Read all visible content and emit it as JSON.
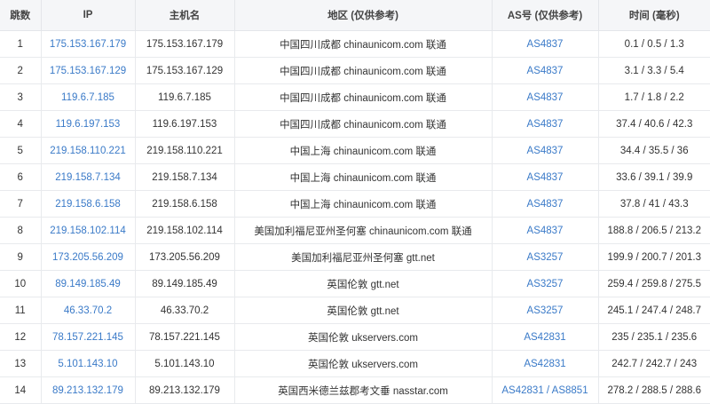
{
  "headers": {
    "hop": "跳数",
    "ip": "IP",
    "hostname": "主机名",
    "region": "地区 (仅供参考)",
    "as": "AS号 (仅供参考)",
    "time": "时间 (毫秒)"
  },
  "rows": [
    {
      "hop": "1",
      "ip": "175.153.167.179",
      "hostname": "175.153.167.179",
      "region": "中国四川成都 chinaunicom.com 联通",
      "as": [
        "AS4837"
      ],
      "time": "0.1 / 0.5 / 1.3"
    },
    {
      "hop": "2",
      "ip": "175.153.167.129",
      "hostname": "175.153.167.129",
      "region": "中国四川成都 chinaunicom.com 联通",
      "as": [
        "AS4837"
      ],
      "time": "3.1 / 3.3 / 5.4"
    },
    {
      "hop": "3",
      "ip": "119.6.7.185",
      "hostname": "119.6.7.185",
      "region": "中国四川成都 chinaunicom.com 联通",
      "as": [
        "AS4837"
      ],
      "time": "1.7 / 1.8 / 2.2"
    },
    {
      "hop": "4",
      "ip": "119.6.197.153",
      "hostname": "119.6.197.153",
      "region": "中国四川成都 chinaunicom.com 联通",
      "as": [
        "AS4837"
      ],
      "time": "37.4 / 40.6 / 42.3"
    },
    {
      "hop": "5",
      "ip": "219.158.110.221",
      "hostname": "219.158.110.221",
      "region": "中国上海 chinaunicom.com 联通",
      "as": [
        "AS4837"
      ],
      "time": "34.4 / 35.5 / 36"
    },
    {
      "hop": "6",
      "ip": "219.158.7.134",
      "hostname": "219.158.7.134",
      "region": "中国上海 chinaunicom.com 联通",
      "as": [
        "AS4837"
      ],
      "time": "33.6 / 39.1 / 39.9"
    },
    {
      "hop": "7",
      "ip": "219.158.6.158",
      "hostname": "219.158.6.158",
      "region": "中国上海 chinaunicom.com 联通",
      "as": [
        "AS4837"
      ],
      "time": "37.8 / 41 / 43.3"
    },
    {
      "hop": "8",
      "ip": "219.158.102.114",
      "hostname": "219.158.102.114",
      "region": "美国加利福尼亚州圣何塞 chinaunicom.com 联通",
      "as": [
        "AS4837"
      ],
      "time": "188.8 / 206.5 / 213.2"
    },
    {
      "hop": "9",
      "ip": "173.205.56.209",
      "hostname": "173.205.56.209",
      "region": "美国加利福尼亚州圣何塞 gtt.net",
      "as": [
        "AS3257"
      ],
      "time": "199.9 / 200.7 / 201.3"
    },
    {
      "hop": "10",
      "ip": "89.149.185.49",
      "hostname": "89.149.185.49",
      "region": "英国伦敦 gtt.net",
      "as": [
        "AS3257"
      ],
      "time": "259.4 / 259.8 / 275.5"
    },
    {
      "hop": "11",
      "ip": "46.33.70.2",
      "hostname": "46.33.70.2",
      "region": "英国伦敦 gtt.net",
      "as": [
        "AS3257"
      ],
      "time": "245.1 / 247.4 / 248.7"
    },
    {
      "hop": "12",
      "ip": "78.157.221.145",
      "hostname": "78.157.221.145",
      "region": "英国伦敦 ukservers.com",
      "as": [
        "AS42831"
      ],
      "time": "235 / 235.1 / 235.6"
    },
    {
      "hop": "13",
      "ip": "5.101.143.10",
      "hostname": "5.101.143.10",
      "region": "英国伦敦 ukservers.com",
      "as": [
        "AS42831"
      ],
      "time": "242.7 / 242.7 / 243"
    },
    {
      "hop": "14",
      "ip": "89.213.132.179",
      "hostname": "89.213.132.179",
      "region": "英国西米德兰兹郡考文垂 nasstar.com",
      "as": [
        "AS42831",
        "AS8851"
      ],
      "time": "278.2 / 288.5 / 288.6"
    }
  ],
  "as_separator": " / ",
  "colors": {
    "link": "#3a7ac8",
    "header_bg": "#f5f6f8",
    "border": "#e8eaed",
    "text": "#333333"
  }
}
